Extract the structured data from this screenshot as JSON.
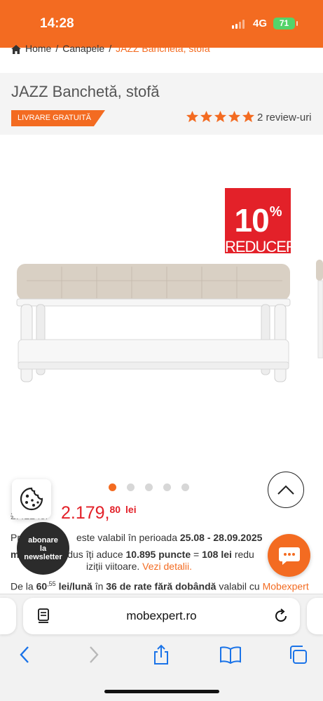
{
  "status_bar": {
    "time": "14:28",
    "network": "4G",
    "battery": "71"
  },
  "breadcrumb": {
    "home": "Home",
    "sep": "/",
    "category": "Canapele",
    "current": "JAZZ Banchetă, stofă"
  },
  "product": {
    "title": "JAZZ Banchetă, stofă",
    "shipping_badge": "LIVRARE GRATUITĂ",
    "rating_stars": 5,
    "reviews": "2 review-uri",
    "discount_percent": "10",
    "discount_percent_sign": "%",
    "discount_label": "REDUCERE",
    "old_price": "2.422 lei",
    "price_main": "2.179,",
    "price_decimals": "80",
    "price_currency": "lei"
  },
  "gallery": {
    "total_images": 5,
    "active_index": 0
  },
  "promo": {
    "line_prefix": "Pr",
    "line_mid": "este valabil în perioada",
    "period": "25.08 - 28.09.2025",
    "points_prefix": "mo",
    "points_mid": "produs îți aduce",
    "points": "10.895 puncte",
    "equals": "=",
    "points_value": "108 lei",
    "points_suffix": "redu",
    "points_line2": "iziții viitoare.",
    "details_link": "Vezi detalii."
  },
  "rates": {
    "prefix": "De la",
    "amount_int": "60",
    "amount_dec": ",55",
    "unit": "lei/lună",
    "mid": "în",
    "count": "36 de rate fără dobândă",
    "suffix": "valabil cu",
    "partner": "Mobexpert"
  },
  "newsletter": {
    "line1": "abonare",
    "line2": "la",
    "line3": "newsletter"
  },
  "browser": {
    "url": "mobexpert.ro"
  },
  "colors": {
    "brand": "#f36b21",
    "discount": "#e32129"
  }
}
